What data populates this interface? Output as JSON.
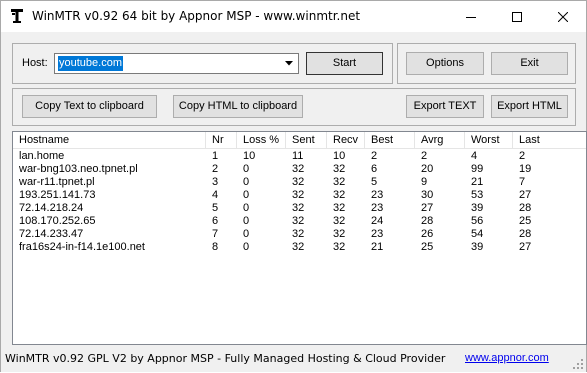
{
  "window": {
    "title": "WinMTR v0.92 64 bit by Appnor MSP - www.winmtr.net",
    "icon": "winmtr-app-icon"
  },
  "host": {
    "label": "Host:",
    "value": "youtube.com"
  },
  "buttons": {
    "start": "Start",
    "options": "Options",
    "exit": "Exit",
    "copy_text": "Copy Text to clipboard",
    "copy_html": "Copy HTML to clipboard",
    "export_text": "Export TEXT",
    "export_html": "Export HTML"
  },
  "table": {
    "columns": [
      "Hostname",
      "Nr",
      "Loss %",
      "Sent",
      "Recv",
      "Best",
      "Avrg",
      "Worst",
      "Last"
    ],
    "rows": [
      [
        "lan.home",
        "1",
        "10",
        "11",
        "10",
        "2",
        "2",
        "4",
        "2"
      ],
      [
        "war-bng103.neo.tpnet.pl",
        "2",
        "0",
        "32",
        "32",
        "6",
        "20",
        "99",
        "19"
      ],
      [
        "war-r11.tpnet.pl",
        "3",
        "0",
        "32",
        "32",
        "5",
        "9",
        "21",
        "7"
      ],
      [
        "193.251.141.73",
        "4",
        "0",
        "32",
        "32",
        "23",
        "30",
        "53",
        "27"
      ],
      [
        "72.14.218.24",
        "5",
        "0",
        "32",
        "32",
        "23",
        "27",
        "39",
        "28"
      ],
      [
        "108.170.252.65",
        "6",
        "0",
        "32",
        "32",
        "24",
        "28",
        "56",
        "25"
      ],
      [
        "72.14.233.47",
        "7",
        "0",
        "32",
        "32",
        "23",
        "26",
        "54",
        "28"
      ],
      [
        "fra16s24-in-f14.1e100.net",
        "8",
        "0",
        "32",
        "32",
        "21",
        "25",
        "39",
        "27"
      ]
    ]
  },
  "status": {
    "text": "WinMTR v0.92 GPL V2 by Appnor MSP - Fully Managed Hosting & Cloud Provider",
    "link": "www.appnor.com"
  },
  "colors": {
    "selection": "#0078d7",
    "link": "#0000ee"
  }
}
